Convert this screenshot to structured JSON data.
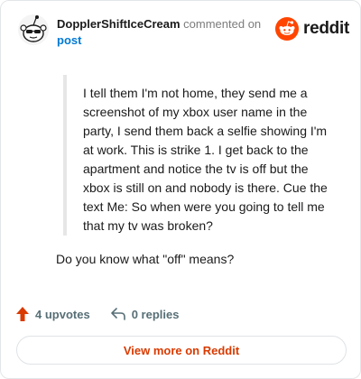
{
  "header": {
    "username": "DopplerShiftIceCream",
    "action_text": "commented on",
    "post_link": "post",
    "brand": "reddit",
    "brand_color": "#ff4500"
  },
  "comment": {
    "quote": "I tell them I'm not home, they send me a screenshot of my xbox user name in the party, I send them back a selfie showing I'm at work. This is strike 1. I get back to the apartment and notice the tv is off but the xbox is still on and nobody is there. Cue the text Me: So when were you going to tell me that my tv was broken?",
    "reply": "Do you know what \"off\" means?"
  },
  "footer": {
    "upvotes_label": "4 upvotes",
    "upvote_icon": "upvote-arrow-icon",
    "replies_label": "0 replies",
    "reply_icon": "reply-arrow-icon",
    "view_more_label": "View more on Reddit",
    "accent_color": "#d93a00"
  }
}
